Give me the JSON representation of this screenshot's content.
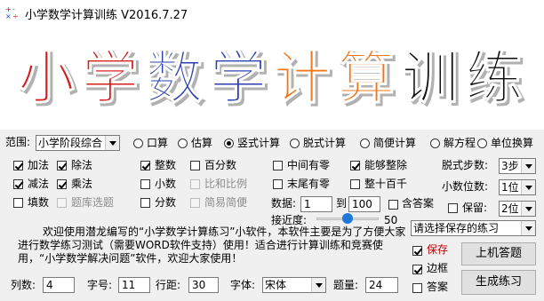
{
  "window": {
    "title": "小学数学计算训练 V2016.7.27"
  },
  "banner": {
    "text": "小学数学计算训练",
    "colors": [
      "#d71c1c",
      "#d71c1c",
      "#2a3fb0",
      "#2a3fb0",
      "#f0781e",
      "#f0781e",
      "#111111",
      "#111111"
    ]
  },
  "range": {
    "label": "范围:",
    "value": "小学阶段综合"
  },
  "modes": [
    {
      "label": "口算",
      "checked": false
    },
    {
      "label": "估算",
      "checked": false
    },
    {
      "label": "竖式计算",
      "checked": true
    },
    {
      "label": "脱式计算",
      "checked": false
    },
    {
      "label": "简便计算",
      "checked": false
    },
    {
      "label": "解方程",
      "checked": false
    },
    {
      "label": "单位换算",
      "checked": false
    }
  ],
  "ops": {
    "add": "加法",
    "sub": "减法",
    "tiankong": "填数",
    "div": "除法",
    "mul": "乘法",
    "tiku": "题库选题",
    "int": "整数",
    "dec": "小数",
    "frac": "分数",
    "pct": "百分数",
    "ratio": "比和比例",
    "simple": "简易简便",
    "midzero": "中间有零",
    "endzero": "末尾有零",
    "exact": "能够整除",
    "round": "整十百千"
  },
  "numrange": {
    "label": "数据:",
    "from": "1",
    "to_label": "到",
    "to": "100",
    "answer_label": "含答案"
  },
  "closeness": {
    "label": "接近度:",
    "value": "50",
    "level": 50
  },
  "steps": {
    "label": "脱式步数:",
    "value": "3步"
  },
  "decimals": {
    "label": "小数位数:",
    "value": "1位"
  },
  "keep": {
    "label": "保留:",
    "value": "2位"
  },
  "saved": {
    "placeholder": "请选择保存的练习"
  },
  "save": {
    "label": "保存"
  },
  "border": {
    "label": "边框"
  },
  "answer2": {
    "label": "答案"
  },
  "buttons": {
    "online": "上机答题",
    "generate": "生成练习"
  },
  "description": "欢迎使用潜龙编写的“小学数学计算练习”小软件，本软件主要是为了方便大家进行数学练习测试（需要WORD软件支持）使用！适合进行计算训练和竞赛使用，“小学数学解决问题”软件，欢迎大家使用！",
  "bottom": {
    "cols_label": "列数:",
    "cols": "4",
    "size_label": "字号:",
    "size": "11",
    "spacing_label": "行距:",
    "spacing": "30",
    "font_label": "字体:",
    "font": "宋体",
    "count_label": "题量:",
    "count": "24"
  }
}
